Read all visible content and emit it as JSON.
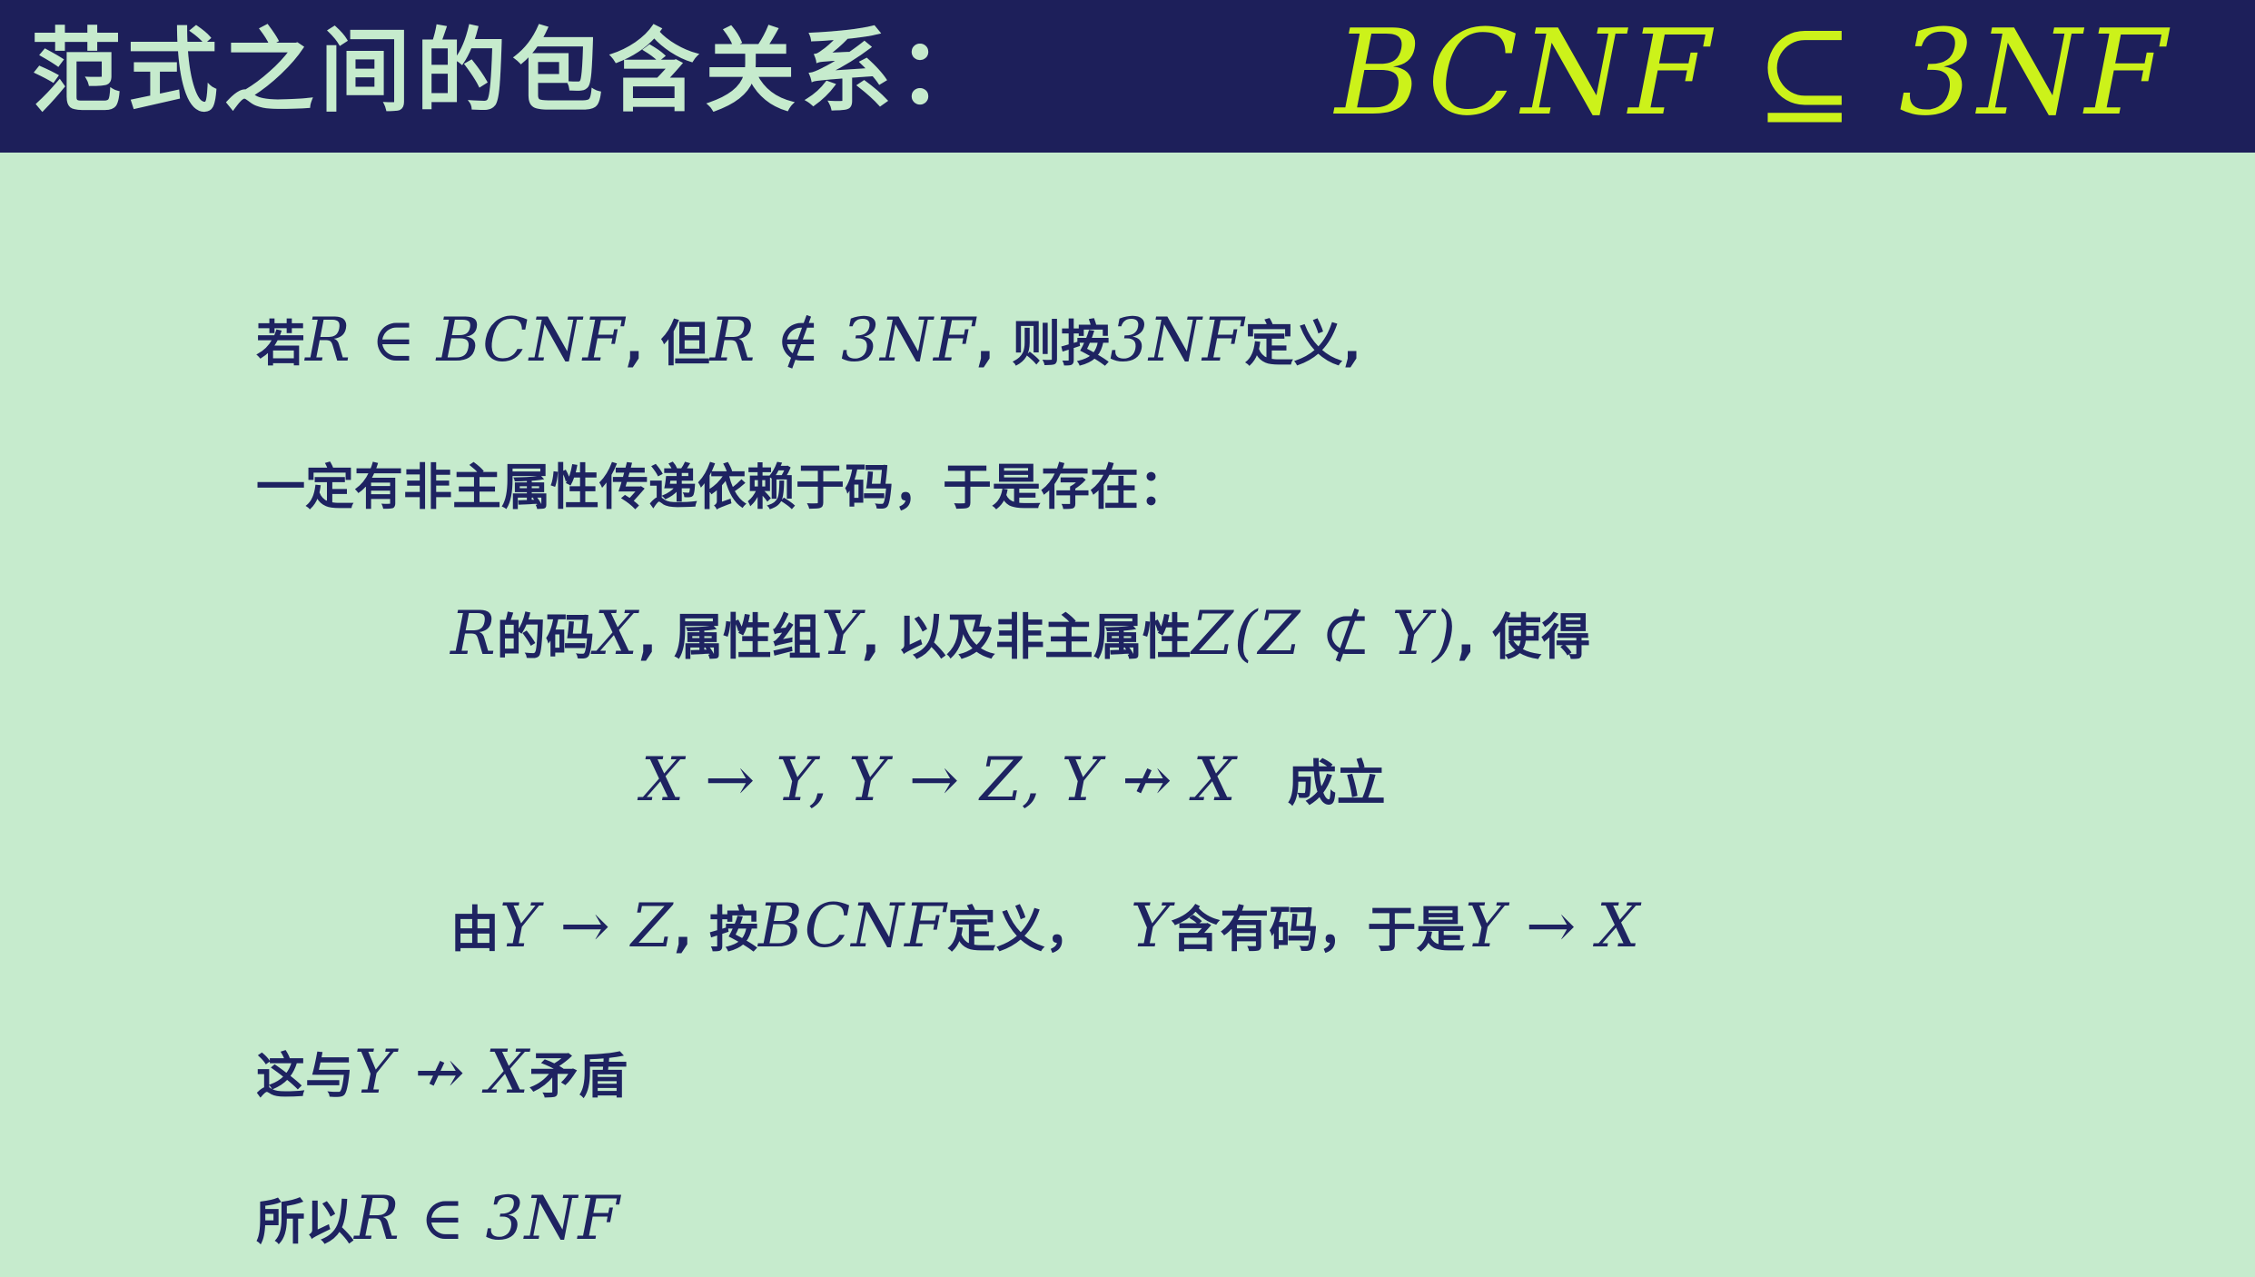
{
  "title": {
    "chinese": "范式之间的包含关系：",
    "math": "BCNF ⊆ 3NF"
  },
  "lines": {
    "line1": {
      "t1": "若",
      "m1": "R ∈ BCNF",
      "t2": ", 但",
      "m2": "R ∉ 3NF",
      "t3": ", 则按",
      "m3": "3NF",
      "t4": "定义,"
    },
    "line2": {
      "t1": "一定有非主属性传递依赖于码，于是存在："
    },
    "line3": {
      "m1": "R",
      "t1": "的码",
      "m2": "X",
      "t2": ", 属性组",
      "m3": "Y",
      "t3": ", 以及非主属性",
      "m4": "Z(Z ⊄ Y)",
      "t4": ", 使得"
    },
    "line4": {
      "m1": "X → Y, Y → Z, Y ↛ X",
      "t1": "成立"
    },
    "line5": {
      "t1": "由",
      "m1": "Y → Z",
      "t2": ", 按",
      "m2": "BCNF",
      "t3": "定义，",
      "m3": "Y",
      "t4": "含有码，于是",
      "m4": "Y → X"
    },
    "line6": {
      "t1": "这与",
      "m1": "Y ↛ X",
      "t2": "矛盾"
    },
    "line7": {
      "t1": "所以",
      "m1": "R ∈ 3NF"
    }
  },
  "colors": {
    "background": "#c6ebcd",
    "title_bar": "#1d1f5a",
    "title_text": "#c6ebcd",
    "title_math": "#ccf21a",
    "body_text": "#1e2361"
  }
}
